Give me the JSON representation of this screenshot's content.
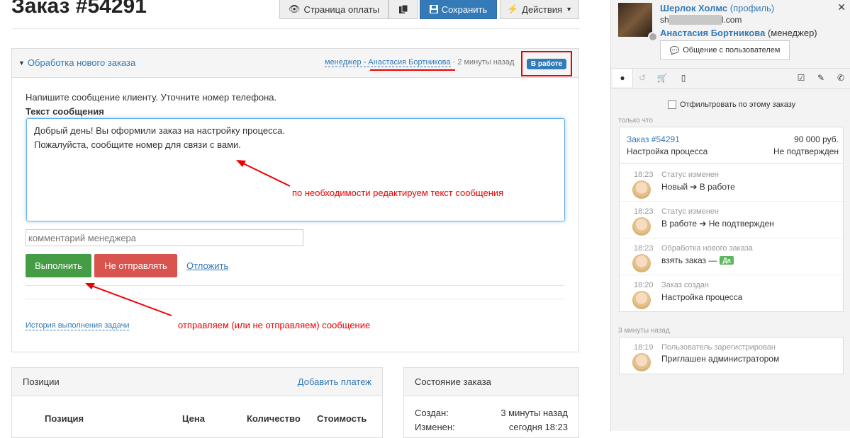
{
  "page": {
    "title": "Заказ #54291"
  },
  "toolbar": {
    "payment_page": "Страница оплаты",
    "save": "Сохранить",
    "actions": "Действия"
  },
  "task": {
    "header_title": "Обработка нового заказа",
    "manager_meta": "менеджер - Анастасия Бортникова",
    "time_meta": "· 2 минуты назад",
    "status": "В работе",
    "instruction": "Напишите сообщение клиенту. Уточните номер телефона.",
    "message_label": "Текст сообщения",
    "message_text": "Добрый день! Вы оформили заказ на настройку процесса.\nПожалуйста, сообщите номер для связи с вами.",
    "comment_placeholder": "комментарий менеджера",
    "execute": "Выполнить",
    "dont_send": "Не отправлять",
    "postpone": "Отложить",
    "history_link": "История выполнения задачи"
  },
  "annotations": {
    "edit_text": "по необходимости редактируем текст сообщения",
    "send_text": "отправляем (или не отправляем) сообщение"
  },
  "positions": {
    "title": "Позиции",
    "add_payment": "Добавить платеж",
    "columns": [
      "Позиция",
      "Цена",
      "Количество",
      "Стоимость"
    ]
  },
  "order_state": {
    "title": "Состояние заказа",
    "rows": [
      {
        "label": "Создан:",
        "value": "3 минуты назад"
      },
      {
        "label": "Изменен:",
        "value": "сегодня 18:23"
      }
    ]
  },
  "sidebar": {
    "user_name": "Шерлок Холмс",
    "profile_link": "(профиль)",
    "email_prefix": "sh",
    "email_suffix": "l.com",
    "manager_name": "Анастасия Бортникова",
    "manager_role": "(менеджер)",
    "chat_button": "Общение с пользователем",
    "filter_label": "Отфильтровать по этому заказу",
    "section_now": "только что",
    "order_link": "Заказ #54291",
    "order_price": "90 000 руб.",
    "order_product": "Настройка процесса",
    "order_status": "Не подтвержден",
    "events": [
      {
        "time": "18:23",
        "title": "Статус изменен",
        "from": "Новый",
        "to": "В работе"
      },
      {
        "time": "18:23",
        "title": "Статус изменен",
        "from": "В работе",
        "to": "Не подтвержден"
      },
      {
        "time": "18:23",
        "title": "Обработка нового заказа",
        "text": "взять заказ —",
        "badge": "Да"
      },
      {
        "time": "18:20",
        "title": "Заказ создан",
        "text": "Настройка процесса"
      }
    ],
    "section_3min": "3 минуты назад",
    "reg_event": {
      "time": "18:19",
      "title": "Пользователь зарегистрирован",
      "text": "Приглашен администратором"
    }
  },
  "colors": {
    "primary": "#337ab7",
    "success": "#449d44",
    "danger": "#d9534f",
    "annotation": "#e00000"
  }
}
